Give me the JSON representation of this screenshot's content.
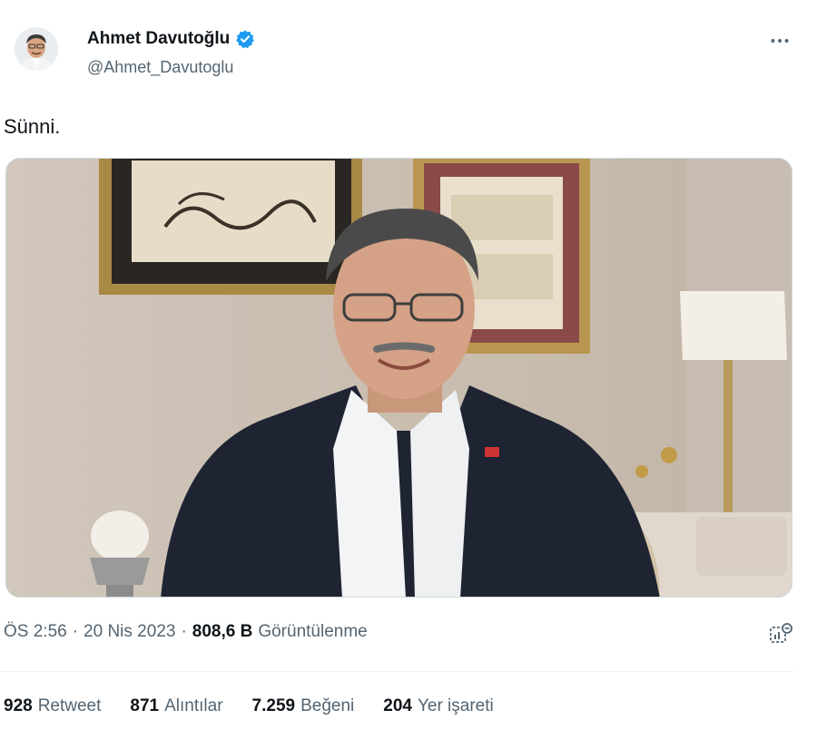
{
  "author": {
    "name": "Ahmet Davutoğlu",
    "handle": "@Ahmet_Davutoglu",
    "verified": true,
    "verified_color": "#1d9bf0"
  },
  "more_icon": "more-horizontal-icon",
  "tweet": {
    "text": "Sünni."
  },
  "meta": {
    "time": "ÖS 2:56",
    "sep1": "·",
    "date": "20 Nis 2023",
    "sep2": "·",
    "views_count": "808,6 B",
    "views_label": "Görüntülenme"
  },
  "stats": [
    {
      "count": "928",
      "label": "Retweet"
    },
    {
      "count": "871",
      "label": "Alıntılar"
    },
    {
      "count": "7.259",
      "label": "Beğeni"
    },
    {
      "count": "204",
      "label": "Yer işareti"
    }
  ],
  "colors": {
    "text": "#0f1419",
    "secondary": "#536471",
    "border": "#eff3f4"
  }
}
